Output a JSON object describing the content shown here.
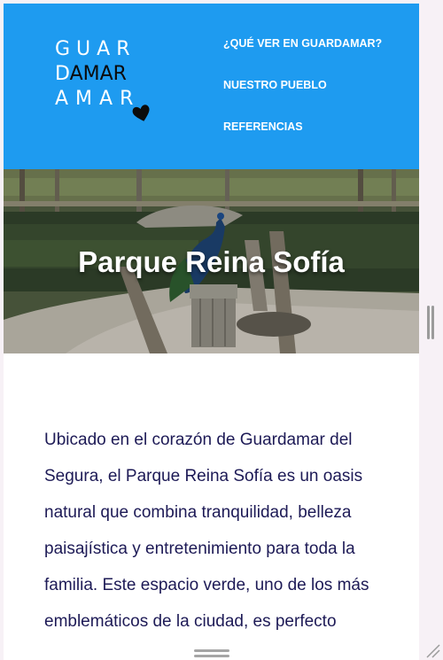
{
  "logo": {
    "line1": "GUAR",
    "line2_prefix": "D",
    "line2_rest": "AMAR",
    "line3": "AMAR",
    "heart_icon": "heart-icon"
  },
  "nav": {
    "items": [
      {
        "label": "¿QUÉ VER EN GUARDAMAR?"
      },
      {
        "label": "NUESTRO PUEBLO"
      },
      {
        "label": "REFERENCIAS"
      }
    ]
  },
  "hero": {
    "title": "Parque Reina Sofía"
  },
  "article": {
    "paragraph": "Ubicado en el corazón de Guardamar del Segura, el Parque Reina Sofía es un oasis natural que combina tranquilidad, belleza paisajística y entretenimiento para toda la familia. Este espacio verde, uno de los más emblemáticos de la ciudad, es perfecto"
  },
  "colors": {
    "header_bg": "#1e9bf0",
    "text": "#1d1a56",
    "page_bg": "#f7f1f6"
  }
}
